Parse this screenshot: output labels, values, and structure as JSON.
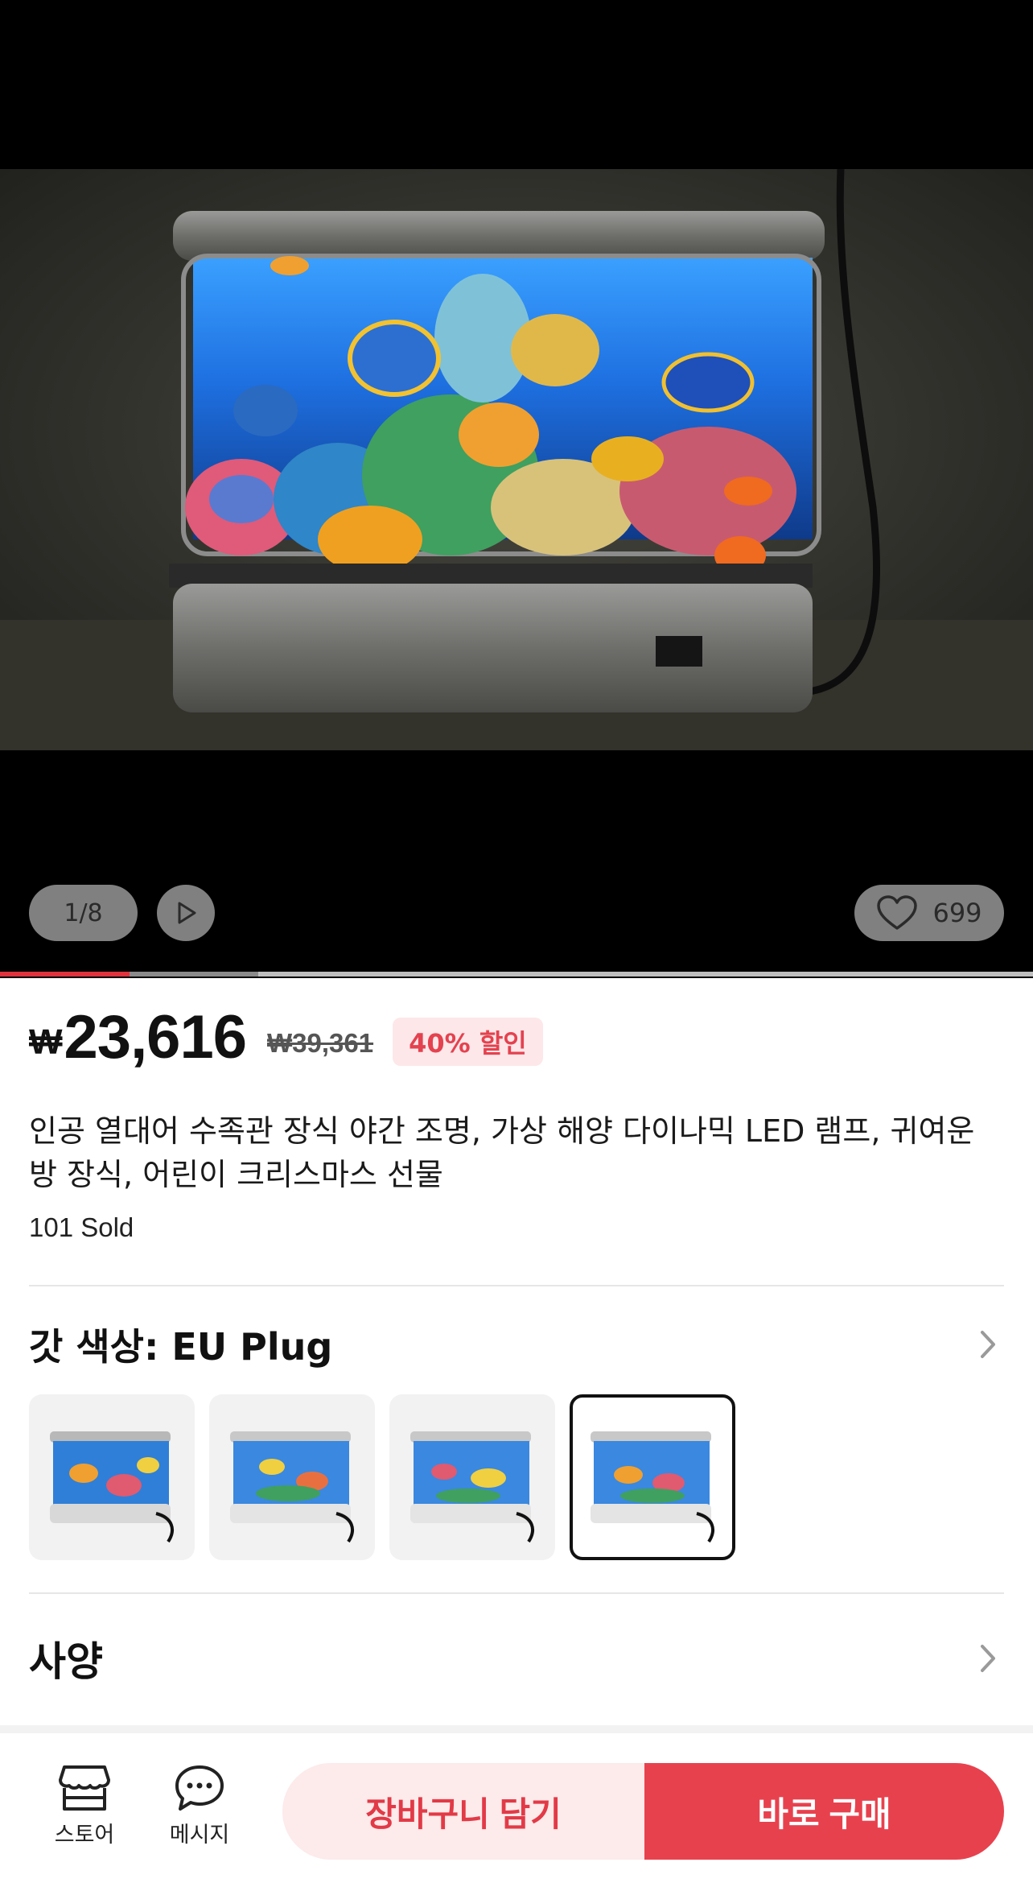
{
  "gallery": {
    "counter": "1/8",
    "favorites": "699",
    "image_alt": "product photo: lit aquarium lamp with tropical fish",
    "progress_active_fraction": 0.125
  },
  "price": {
    "currency": "₩",
    "current": "23,616",
    "original": "₩39,361",
    "discount": "40% 할인"
  },
  "product": {
    "title": "인공 열대어 수족관 장식 야간 조명, 가상 해양 다이나믹 LED 램프, 귀여운 방 장식, 어린이 크리스마스 선물",
    "sold": "101 Sold"
  },
  "variant": {
    "title": "갓 색상: EU Plug",
    "selected_index": 3,
    "options": [
      "Variant 1",
      "Variant 2",
      "Variant 3",
      "EU Plug"
    ]
  },
  "specs": {
    "title": "사양"
  },
  "bottom_bar": {
    "store_label": "스토어",
    "message_label": "메시지",
    "cart_label": "장바구니 담기",
    "buy_label": "바로 구매"
  },
  "colors": {
    "accent": "#e8414e",
    "badge_bg": "#fde7e9",
    "cart_bg": "#fdeaea"
  },
  "icons": [
    "play-icon",
    "heart-icon",
    "chevron-right-icon",
    "store-icon",
    "chat-icon"
  ]
}
